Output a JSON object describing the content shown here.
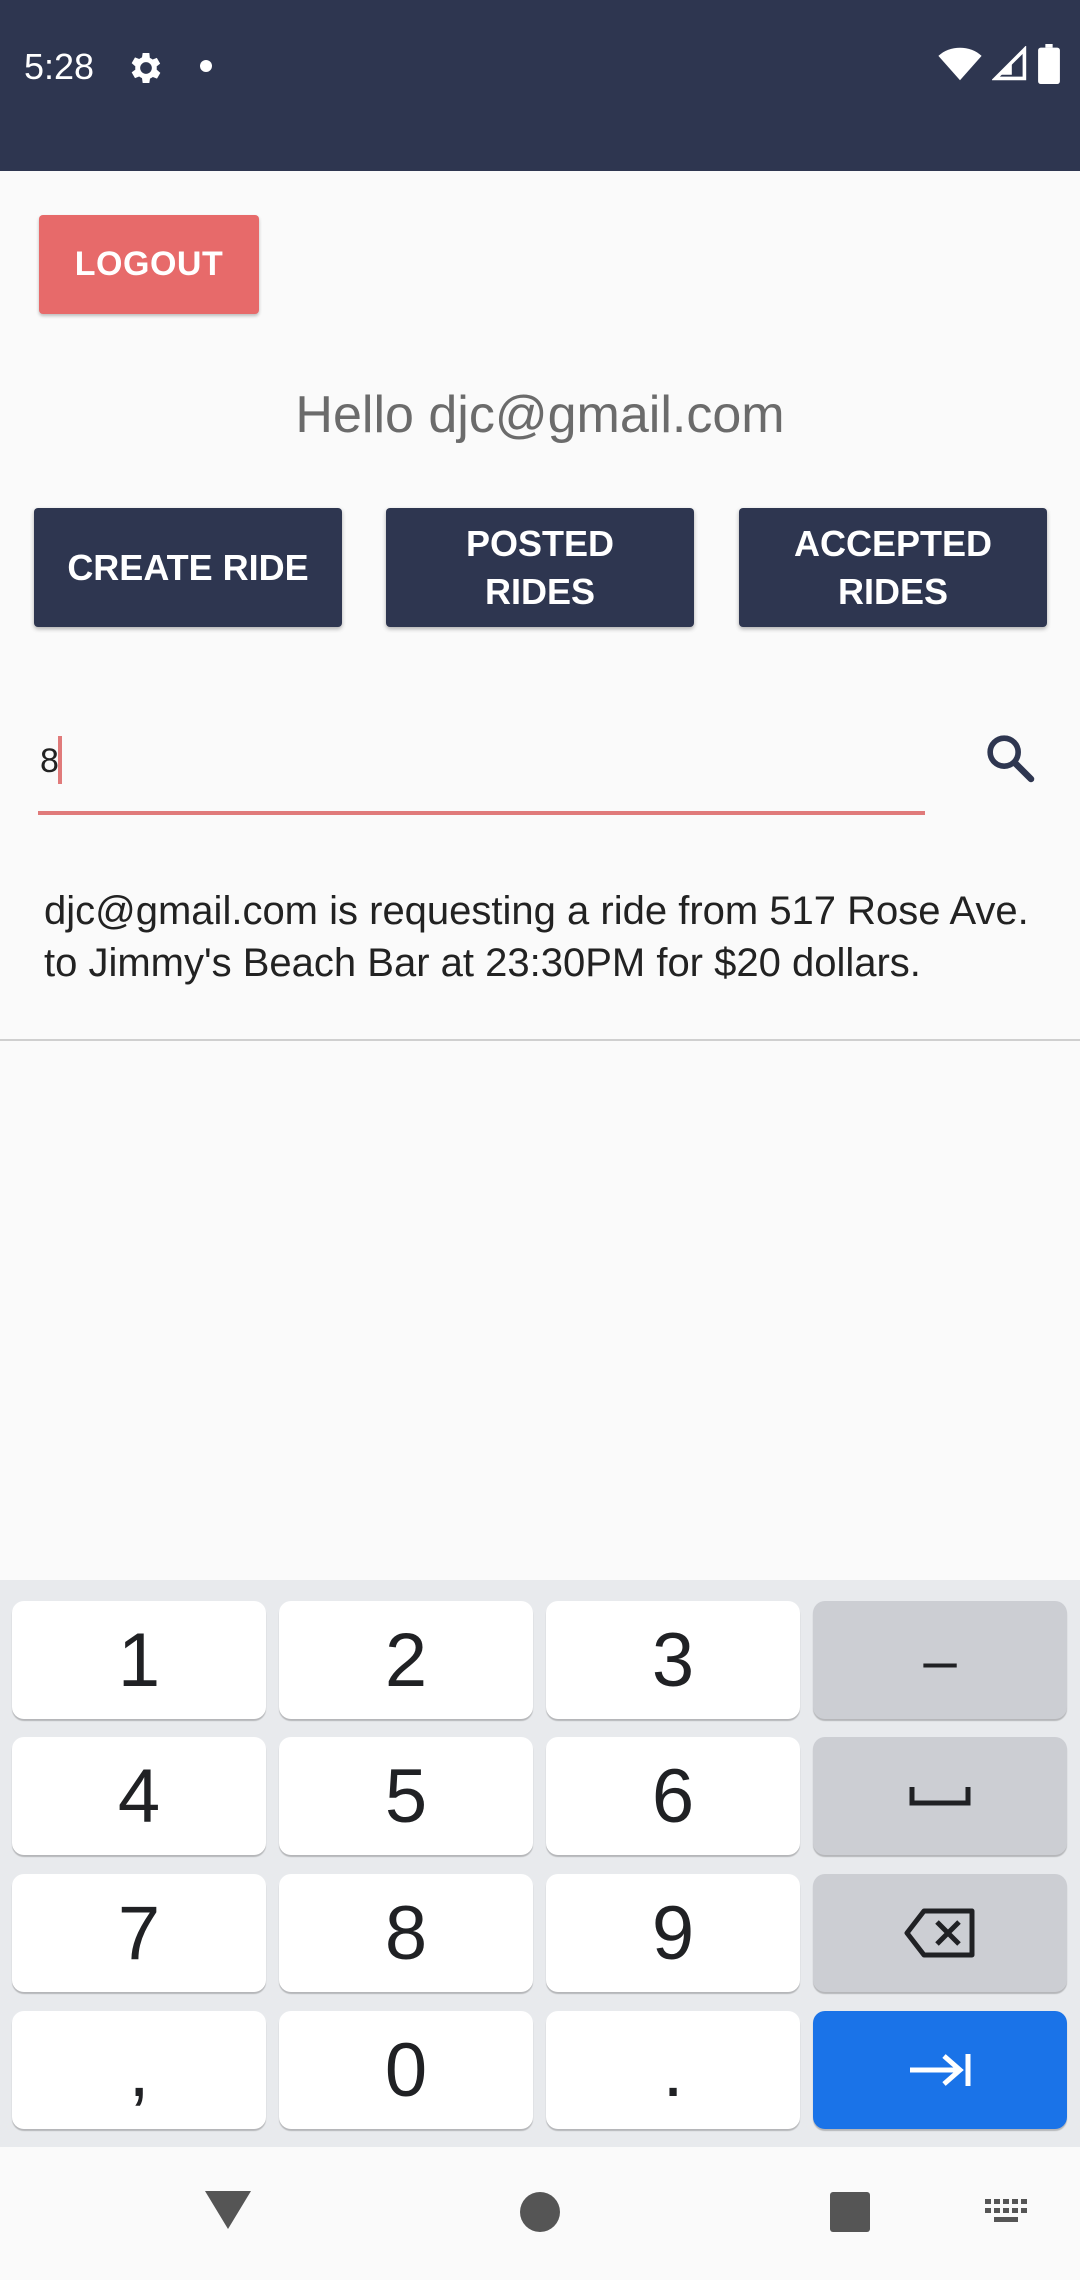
{
  "status_bar": {
    "time": "5:28",
    "icons": [
      "gear-icon",
      "dot-icon",
      "wifi-icon",
      "signal-icon",
      "battery-icon"
    ]
  },
  "header": {
    "logout_label": "LOGOUT",
    "greeting": "Hello djc@gmail.com"
  },
  "nav": {
    "create_ride": "CREATE RIDE",
    "posted_rides": "POSTED RIDES",
    "accepted_rides": "ACCEPTED RIDES"
  },
  "search": {
    "value": "8"
  },
  "rides": [
    {
      "text": "djc@gmail.com is requesting a ride from 517 Rose Ave. to Jimmy's Beach Bar at 23:30PM for $20 dollars."
    }
  ],
  "keyboard": {
    "row1": [
      "1",
      "2",
      "3",
      "–"
    ],
    "row2": [
      "4",
      "5",
      "6"
    ],
    "row3": [
      "7",
      "8",
      "9"
    ],
    "row4": [
      ",",
      "0",
      "."
    ]
  },
  "colors": {
    "primary": "#2e3650",
    "accent": "#e76a6a",
    "keyboard_action": "#1a73e8"
  }
}
